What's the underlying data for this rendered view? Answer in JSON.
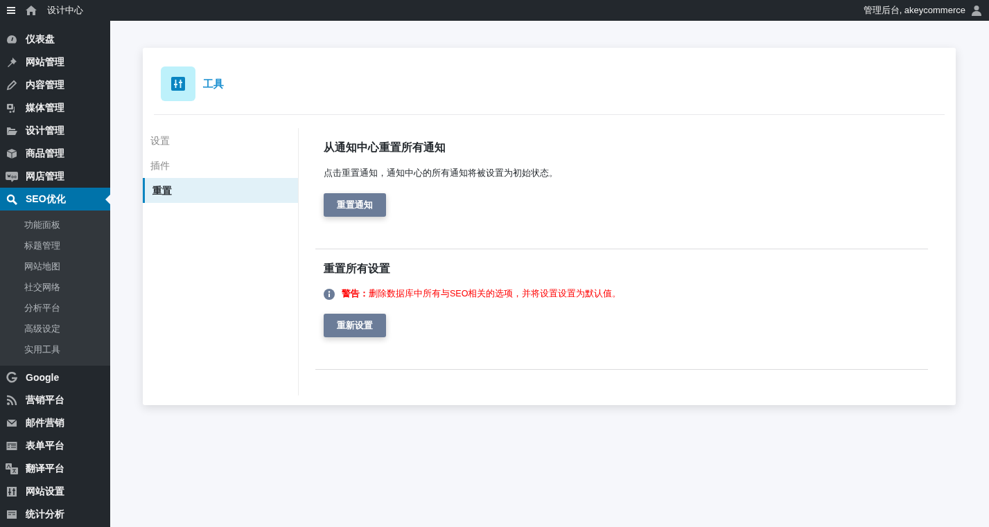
{
  "topbar": {
    "site_title": "设计中心",
    "account": "管理后台, akeycommerce"
  },
  "sidebar": {
    "items": [
      {
        "label": "仪表盘",
        "selected": false
      },
      {
        "label": "网站管理",
        "selected": false
      },
      {
        "label": "内容管理",
        "selected": false
      },
      {
        "label": "媒体管理",
        "selected": false
      },
      {
        "label": "设计管理",
        "selected": false
      },
      {
        "label": "商品管理",
        "selected": false
      },
      {
        "label": "网店管理",
        "selected": false
      },
      {
        "label": "SEO优化",
        "selected": true,
        "children": [
          {
            "label": "功能面板",
            "selected": false
          },
          {
            "label": "标题管理",
            "selected": false
          },
          {
            "label": "网站地图",
            "selected": false
          },
          {
            "label": "社交网络",
            "selected": false
          },
          {
            "label": "分析平台",
            "selected": false
          },
          {
            "label": "高级设定",
            "selected": false
          },
          {
            "label": "实用工具",
            "selected": false
          }
        ]
      },
      {
        "label": "Google",
        "selected": false
      },
      {
        "label": "营销平台",
        "selected": false
      },
      {
        "label": "邮件营销",
        "selected": false
      },
      {
        "label": "表单平台",
        "selected": false
      },
      {
        "label": "翻译平台",
        "selected": false
      },
      {
        "label": "网站设置",
        "selected": false
      },
      {
        "label": "统计分析",
        "selected": false
      }
    ]
  },
  "card": {
    "title": "工具",
    "tabs": [
      {
        "label": "设置",
        "selected": false
      },
      {
        "label": "插件",
        "selected": false
      },
      {
        "label": "重置",
        "selected": true
      }
    ],
    "sections": [
      {
        "title": "从通知中心重置所有通知",
        "description": "点击重置通知，通知中心的所有通知将被设置为初始状态。",
        "button": "重置通知"
      },
      {
        "title": "重置所有设置",
        "warning": "**警告：**删除数据库中所有与SEO相关的选项，并将设置设置为默认值。",
        "button": "重新设置"
      }
    ]
  }
}
